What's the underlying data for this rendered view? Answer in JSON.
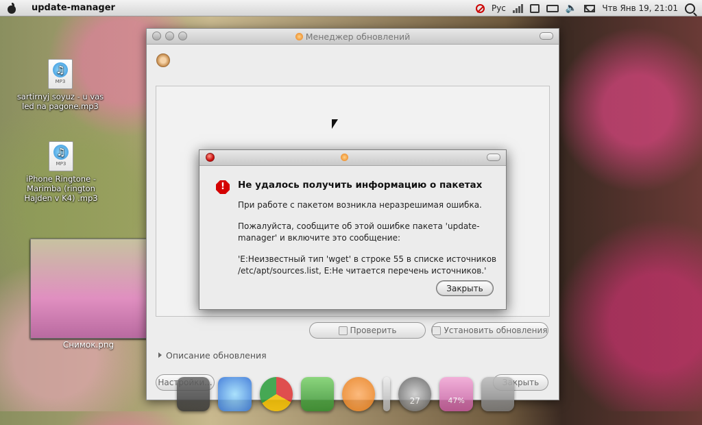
{
  "top_panel": {
    "app_name": "update-manager",
    "keyboard_layout": "Рус",
    "datetime": "Чтв Янв 19, 21:01"
  },
  "desktop": {
    "icons": [
      {
        "label": "sartirnyj soyuz - u vas led na pagone.mp3",
        "badge": "MP3"
      },
      {
        "label": "iPhone Ringtone - Marimba (rington Hajden v K4) .mp3",
        "badge": "MP3"
      },
      {
        "label": "Снимок.png"
      }
    ]
  },
  "main_window": {
    "title": "Менеджер обновлений",
    "check_button": "Проверить",
    "install_button": "Установить обновления",
    "description_expander": "Описание обновления",
    "settings_button": "Настройки...",
    "close_button": "Закрыть"
  },
  "error_dialog": {
    "title": "Не удалось получить информацию о пакетах",
    "line1": "При работе с пакетом возникла неразрешимая ошибка.",
    "line2": "Пожалуйста, сообщите об этой ошибке пакета 'update-manager' и включите это сообщение:",
    "line3": "'E:Неизвестный тип 'wget' в строке 55 в списке источников /etc/apt/sources.list, E:Не читается перечень источников.'",
    "close_button": "Закрыть"
  },
  "dock": {
    "badges": [
      "27",
      "47%"
    ]
  },
  "colors": {
    "error_red": "#d40000",
    "accent_orange": "#e87a12"
  }
}
